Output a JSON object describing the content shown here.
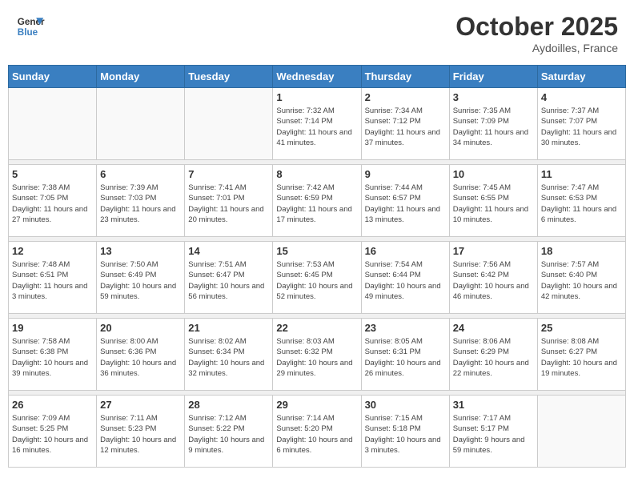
{
  "header": {
    "logo_line1": "General",
    "logo_line2": "Blue",
    "month": "October 2025",
    "location": "Aydoilles, France"
  },
  "weekdays": [
    "Sunday",
    "Monday",
    "Tuesday",
    "Wednesday",
    "Thursday",
    "Friday",
    "Saturday"
  ],
  "weeks": [
    [
      {
        "day": "",
        "sunrise": "",
        "sunset": "",
        "daylight": ""
      },
      {
        "day": "",
        "sunrise": "",
        "sunset": "",
        "daylight": ""
      },
      {
        "day": "",
        "sunrise": "",
        "sunset": "",
        "daylight": ""
      },
      {
        "day": "1",
        "sunrise": "Sunrise: 7:32 AM",
        "sunset": "Sunset: 7:14 PM",
        "daylight": "Daylight: 11 hours and 41 minutes."
      },
      {
        "day": "2",
        "sunrise": "Sunrise: 7:34 AM",
        "sunset": "Sunset: 7:12 PM",
        "daylight": "Daylight: 11 hours and 37 minutes."
      },
      {
        "day": "3",
        "sunrise": "Sunrise: 7:35 AM",
        "sunset": "Sunset: 7:09 PM",
        "daylight": "Daylight: 11 hours and 34 minutes."
      },
      {
        "day": "4",
        "sunrise": "Sunrise: 7:37 AM",
        "sunset": "Sunset: 7:07 PM",
        "daylight": "Daylight: 11 hours and 30 minutes."
      }
    ],
    [
      {
        "day": "5",
        "sunrise": "Sunrise: 7:38 AM",
        "sunset": "Sunset: 7:05 PM",
        "daylight": "Daylight: 11 hours and 27 minutes."
      },
      {
        "day": "6",
        "sunrise": "Sunrise: 7:39 AM",
        "sunset": "Sunset: 7:03 PM",
        "daylight": "Daylight: 11 hours and 23 minutes."
      },
      {
        "day": "7",
        "sunrise": "Sunrise: 7:41 AM",
        "sunset": "Sunset: 7:01 PM",
        "daylight": "Daylight: 11 hours and 20 minutes."
      },
      {
        "day": "8",
        "sunrise": "Sunrise: 7:42 AM",
        "sunset": "Sunset: 6:59 PM",
        "daylight": "Daylight: 11 hours and 17 minutes."
      },
      {
        "day": "9",
        "sunrise": "Sunrise: 7:44 AM",
        "sunset": "Sunset: 6:57 PM",
        "daylight": "Daylight: 11 hours and 13 minutes."
      },
      {
        "day": "10",
        "sunrise": "Sunrise: 7:45 AM",
        "sunset": "Sunset: 6:55 PM",
        "daylight": "Daylight: 11 hours and 10 minutes."
      },
      {
        "day": "11",
        "sunrise": "Sunrise: 7:47 AM",
        "sunset": "Sunset: 6:53 PM",
        "daylight": "Daylight: 11 hours and 6 minutes."
      }
    ],
    [
      {
        "day": "12",
        "sunrise": "Sunrise: 7:48 AM",
        "sunset": "Sunset: 6:51 PM",
        "daylight": "Daylight: 11 hours and 3 minutes."
      },
      {
        "day": "13",
        "sunrise": "Sunrise: 7:50 AM",
        "sunset": "Sunset: 6:49 PM",
        "daylight": "Daylight: 10 hours and 59 minutes."
      },
      {
        "day": "14",
        "sunrise": "Sunrise: 7:51 AM",
        "sunset": "Sunset: 6:47 PM",
        "daylight": "Daylight: 10 hours and 56 minutes."
      },
      {
        "day": "15",
        "sunrise": "Sunrise: 7:53 AM",
        "sunset": "Sunset: 6:45 PM",
        "daylight": "Daylight: 10 hours and 52 minutes."
      },
      {
        "day": "16",
        "sunrise": "Sunrise: 7:54 AM",
        "sunset": "Sunset: 6:44 PM",
        "daylight": "Daylight: 10 hours and 49 minutes."
      },
      {
        "day": "17",
        "sunrise": "Sunrise: 7:56 AM",
        "sunset": "Sunset: 6:42 PM",
        "daylight": "Daylight: 10 hours and 46 minutes."
      },
      {
        "day": "18",
        "sunrise": "Sunrise: 7:57 AM",
        "sunset": "Sunset: 6:40 PM",
        "daylight": "Daylight: 10 hours and 42 minutes."
      }
    ],
    [
      {
        "day": "19",
        "sunrise": "Sunrise: 7:58 AM",
        "sunset": "Sunset: 6:38 PM",
        "daylight": "Daylight: 10 hours and 39 minutes."
      },
      {
        "day": "20",
        "sunrise": "Sunrise: 8:00 AM",
        "sunset": "Sunset: 6:36 PM",
        "daylight": "Daylight: 10 hours and 36 minutes."
      },
      {
        "day": "21",
        "sunrise": "Sunrise: 8:02 AM",
        "sunset": "Sunset: 6:34 PM",
        "daylight": "Daylight: 10 hours and 32 minutes."
      },
      {
        "day": "22",
        "sunrise": "Sunrise: 8:03 AM",
        "sunset": "Sunset: 6:32 PM",
        "daylight": "Daylight: 10 hours and 29 minutes."
      },
      {
        "day": "23",
        "sunrise": "Sunrise: 8:05 AM",
        "sunset": "Sunset: 6:31 PM",
        "daylight": "Daylight: 10 hours and 26 minutes."
      },
      {
        "day": "24",
        "sunrise": "Sunrise: 8:06 AM",
        "sunset": "Sunset: 6:29 PM",
        "daylight": "Daylight: 10 hours and 22 minutes."
      },
      {
        "day": "25",
        "sunrise": "Sunrise: 8:08 AM",
        "sunset": "Sunset: 6:27 PM",
        "daylight": "Daylight: 10 hours and 19 minutes."
      }
    ],
    [
      {
        "day": "26",
        "sunrise": "Sunrise: 7:09 AM",
        "sunset": "Sunset: 5:25 PM",
        "daylight": "Daylight: 10 hours and 16 minutes."
      },
      {
        "day": "27",
        "sunrise": "Sunrise: 7:11 AM",
        "sunset": "Sunset: 5:23 PM",
        "daylight": "Daylight: 10 hours and 12 minutes."
      },
      {
        "day": "28",
        "sunrise": "Sunrise: 7:12 AM",
        "sunset": "Sunset: 5:22 PM",
        "daylight": "Daylight: 10 hours and 9 minutes."
      },
      {
        "day": "29",
        "sunrise": "Sunrise: 7:14 AM",
        "sunset": "Sunset: 5:20 PM",
        "daylight": "Daylight: 10 hours and 6 minutes."
      },
      {
        "day": "30",
        "sunrise": "Sunrise: 7:15 AM",
        "sunset": "Sunset: 5:18 PM",
        "daylight": "Daylight: 10 hours and 3 minutes."
      },
      {
        "day": "31",
        "sunrise": "Sunrise: 7:17 AM",
        "sunset": "Sunset: 5:17 PM",
        "daylight": "Daylight: 9 hours and 59 minutes."
      },
      {
        "day": "",
        "sunrise": "",
        "sunset": "",
        "daylight": ""
      }
    ]
  ]
}
